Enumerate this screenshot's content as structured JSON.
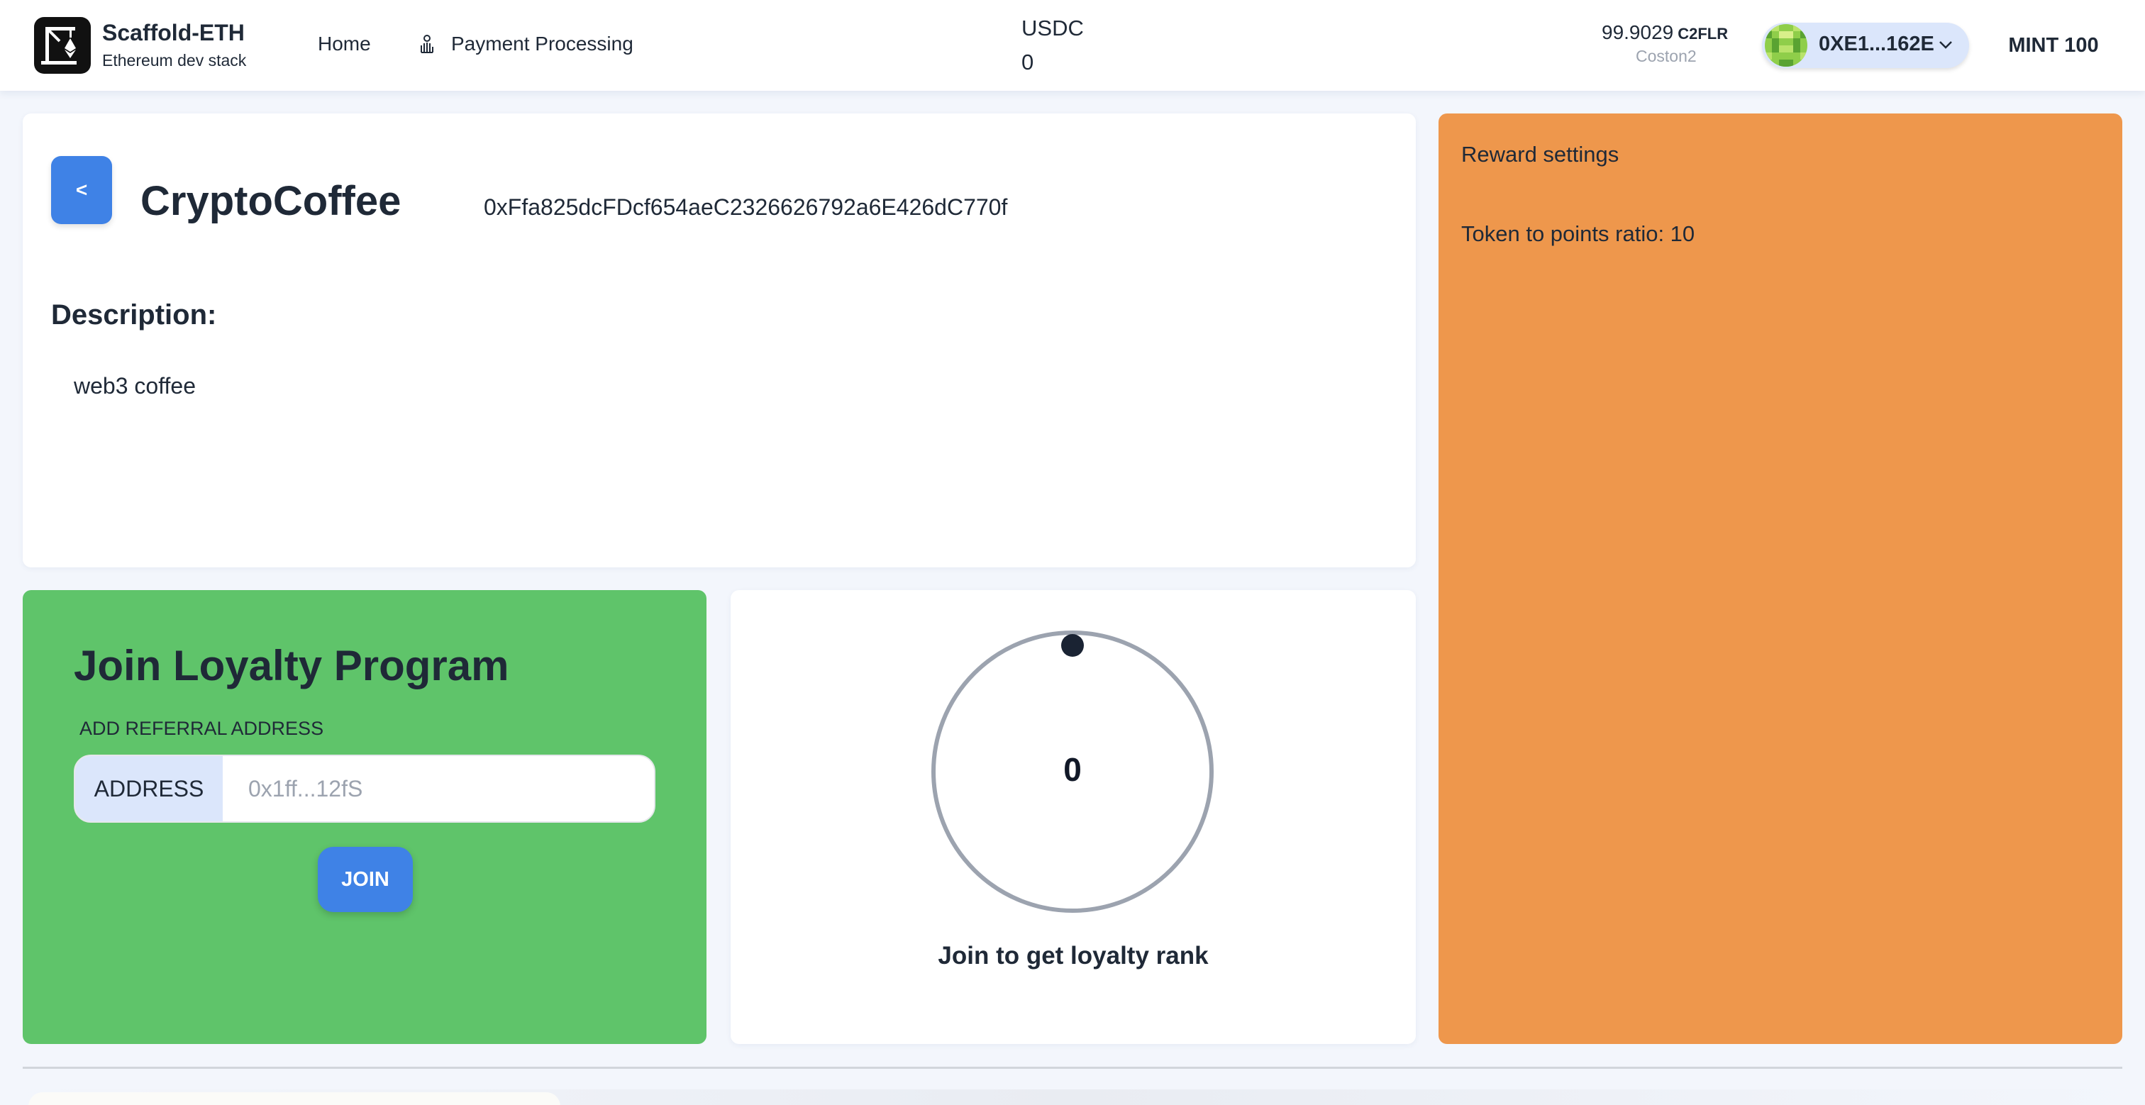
{
  "header": {
    "brand_title": "Scaffold-ETH",
    "brand_subtitle": "Ethereum dev stack",
    "nav": {
      "home": "Home",
      "payment_processing": "Payment Processing"
    },
    "token": {
      "label": "USDC",
      "value": "0"
    },
    "wallet": {
      "balance": "99.9029",
      "unit": "C2FLR",
      "network": "Coston2",
      "account": "0XE1...162E"
    },
    "mint_label": "MINT 100",
    "icons": [
      "scaffold-logo-icon",
      "payment-hand-icon",
      "blockie-avatar",
      "chevron-down-icon"
    ]
  },
  "shop": {
    "back_label": "<",
    "name": "CryptoCoffee",
    "address": "0xFfa825dcFDcf654aeC2326626792a6E426dC770f",
    "description_heading": "Description:",
    "description": "web3 coffee"
  },
  "reward_settings": {
    "title": "Reward settings",
    "ratio_text": "Token to points ratio: 10"
  },
  "join": {
    "title": "Join Loyalty Program",
    "referral_label": "ADD REFERRAL ADDRESS",
    "address_prefix": "ADDRESS",
    "address_placeholder": "0x1ff...12fS",
    "address_value": "",
    "join_label": "JOIN"
  },
  "rank": {
    "value": "0",
    "caption": "Join to get loyalty rank"
  },
  "colors": {
    "primary_button": "#3f82e6",
    "join_card": "#5fc46a",
    "reward_card": "#ee974c",
    "account_pill": "#dbe6fb"
  }
}
